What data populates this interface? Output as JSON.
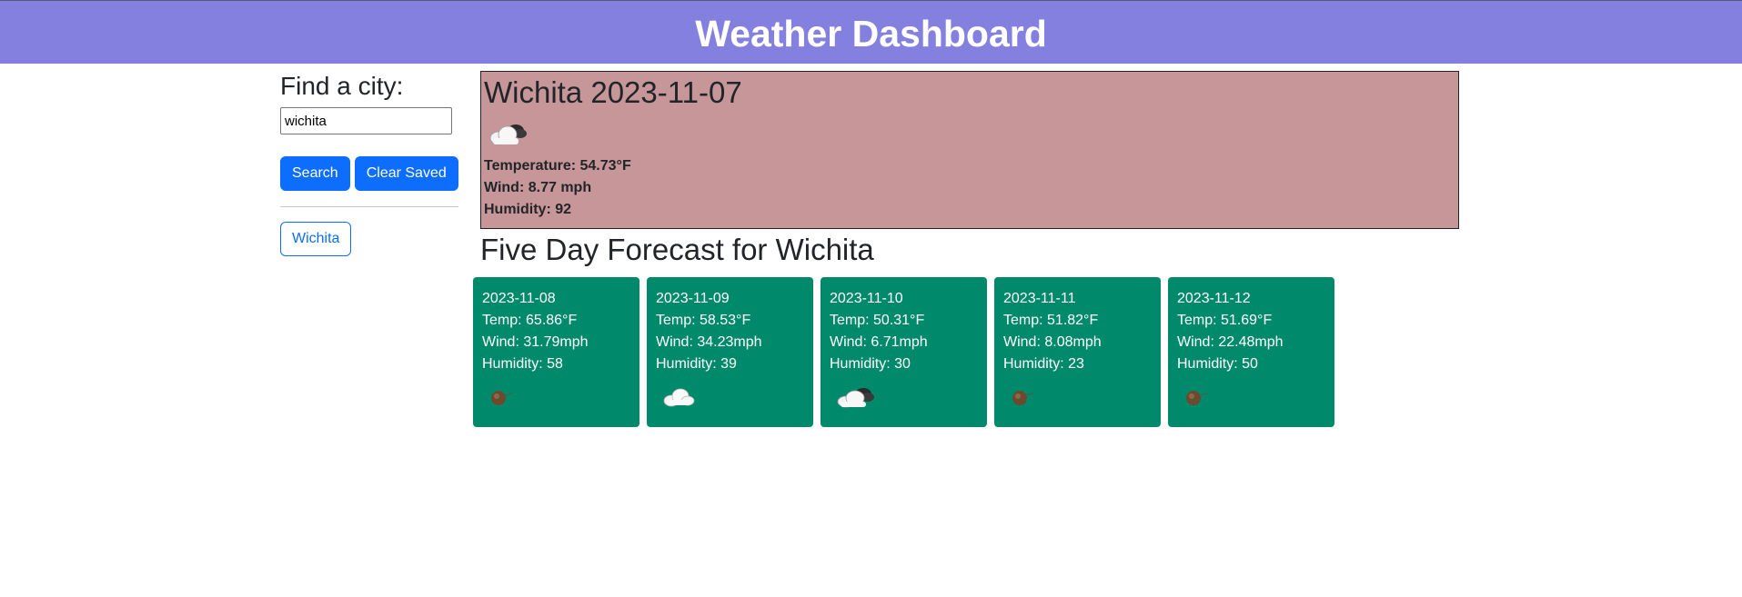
{
  "header": {
    "title": "Weather Dashboard"
  },
  "sidebar": {
    "find_label": "Find a city:",
    "search_value": "wichita",
    "search_button": "Search",
    "clear_button": "Clear Saved",
    "saved_cities": [
      "Wichita"
    ]
  },
  "current": {
    "title": "Wichita 2023-11-07",
    "icon": "cloud-icon",
    "temperature": "Temperature: 54.73°F",
    "wind": "Wind: 8.77 mph",
    "humidity": "Humidity: 92"
  },
  "forecast": {
    "title": "Five Day Forecast for Wichita",
    "days": [
      {
        "date": "2023-11-08",
        "temp": "Temp: 65.86°F",
        "wind": "Wind: 31.79mph",
        "humidity": "Humidity: 58",
        "icon": "ball-icon"
      },
      {
        "date": "2023-11-09",
        "temp": "Temp: 58.53°F",
        "wind": "Wind: 34.23mph",
        "humidity": "Humidity: 39",
        "icon": "white-cloud-icon"
      },
      {
        "date": "2023-11-10",
        "temp": "Temp: 50.31°F",
        "wind": "Wind: 6.71mph",
        "humidity": "Humidity: 30",
        "icon": "cloud-icon"
      },
      {
        "date": "2023-11-11",
        "temp": "Temp: 51.82°F",
        "wind": "Wind: 8.08mph",
        "humidity": "Humidity: 23",
        "icon": "ball-icon"
      },
      {
        "date": "2023-11-12",
        "temp": "Temp: 51.69°F",
        "wind": "Wind: 22.48mph",
        "humidity": "Humidity: 50",
        "icon": "ball-icon"
      }
    ]
  },
  "colors": {
    "header_bg": "#8380df",
    "current_bg": "#c79698",
    "card_bg": "#00896b",
    "primary": "#0d6efd"
  }
}
